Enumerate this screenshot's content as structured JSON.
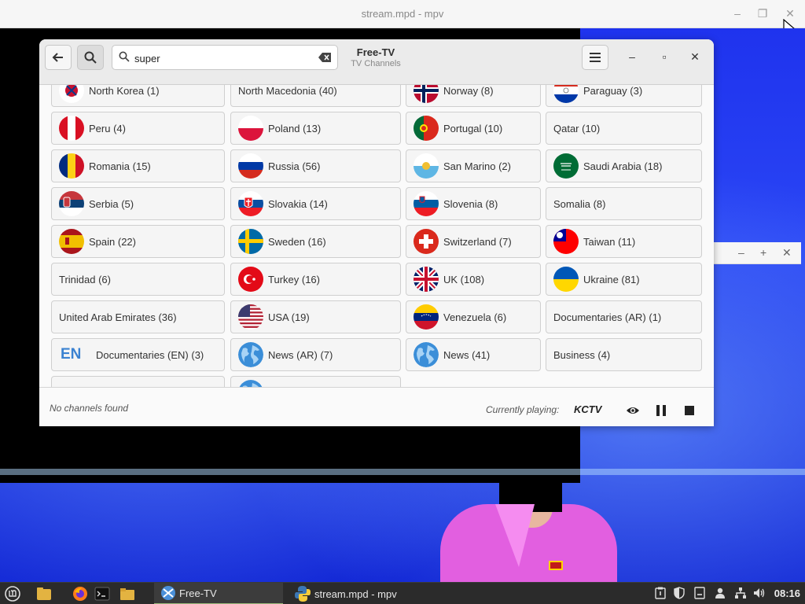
{
  "mpv": {
    "title": "stream.mpd - mpv"
  },
  "app": {
    "title": "Free-TV",
    "subtitle": "TV Channels",
    "search": {
      "value": "super",
      "placeholder": ""
    },
    "status": "No channels found",
    "currently_playing_label": "Currently playing:",
    "currently_playing_channel": "KCTV"
  },
  "cards": [
    {
      "label": "North Korea (1)",
      "flag": "kp"
    },
    {
      "label": "North Macedonia (40)",
      "flag": ""
    },
    {
      "label": "Norway (8)",
      "flag": "no"
    },
    {
      "label": "Paraguay (3)",
      "flag": "py"
    },
    {
      "label": "Peru (4)",
      "flag": "pe"
    },
    {
      "label": "Poland (13)",
      "flag": "pl"
    },
    {
      "label": "Portugal (10)",
      "flag": "pt"
    },
    {
      "label": "Qatar (10)",
      "flag": ""
    },
    {
      "label": "Romania (15)",
      "flag": "ro"
    },
    {
      "label": "Russia (56)",
      "flag": "ru"
    },
    {
      "label": "San Marino (2)",
      "flag": "sm"
    },
    {
      "label": "Saudi Arabia (18)",
      "flag": "sa"
    },
    {
      "label": "Serbia (5)",
      "flag": "rs"
    },
    {
      "label": "Slovakia (14)",
      "flag": "sk"
    },
    {
      "label": "Slovenia (8)",
      "flag": "si"
    },
    {
      "label": "Somalia (8)",
      "flag": ""
    },
    {
      "label": "Spain (22)",
      "flag": "es"
    },
    {
      "label": "Sweden (16)",
      "flag": "se"
    },
    {
      "label": "Switzerland (7)",
      "flag": "ch"
    },
    {
      "label": "Taiwan (11)",
      "flag": "tw"
    },
    {
      "label": "Trinidad (6)",
      "flag": ""
    },
    {
      "label": "Turkey (16)",
      "flag": "tr"
    },
    {
      "label": "UK (108)",
      "flag": "uk"
    },
    {
      "label": "Ukraine (81)",
      "flag": "ua"
    },
    {
      "label": "United Arab Emirates (36)",
      "flag": ""
    },
    {
      "label": "USA (19)",
      "flag": "us"
    },
    {
      "label": "Venezuela (6)",
      "flag": "ve"
    },
    {
      "label": "Documentaries (AR) (1)",
      "flag": ""
    },
    {
      "label": "Documentaries (EN) (3)",
      "flag": "en-text",
      "badge": "EN"
    },
    {
      "label": "News (AR) (7)",
      "flag": "globe"
    },
    {
      "label": "News (41)",
      "flag": "globe"
    },
    {
      "label": "Business (4)",
      "flag": ""
    }
  ],
  "taskbar": {
    "tasks": [
      {
        "label": "Free-TV",
        "icon": "freetv-icon"
      },
      {
        "label": "stream.mpd - mpv",
        "icon": "python-icon"
      }
    ],
    "clock": "08:16"
  },
  "colors": {
    "headerbar": "#ebebeb",
    "card_bg": "#f5f5f5",
    "video_blue": "#1f33ee",
    "taskbar": "#2b2b2b"
  }
}
